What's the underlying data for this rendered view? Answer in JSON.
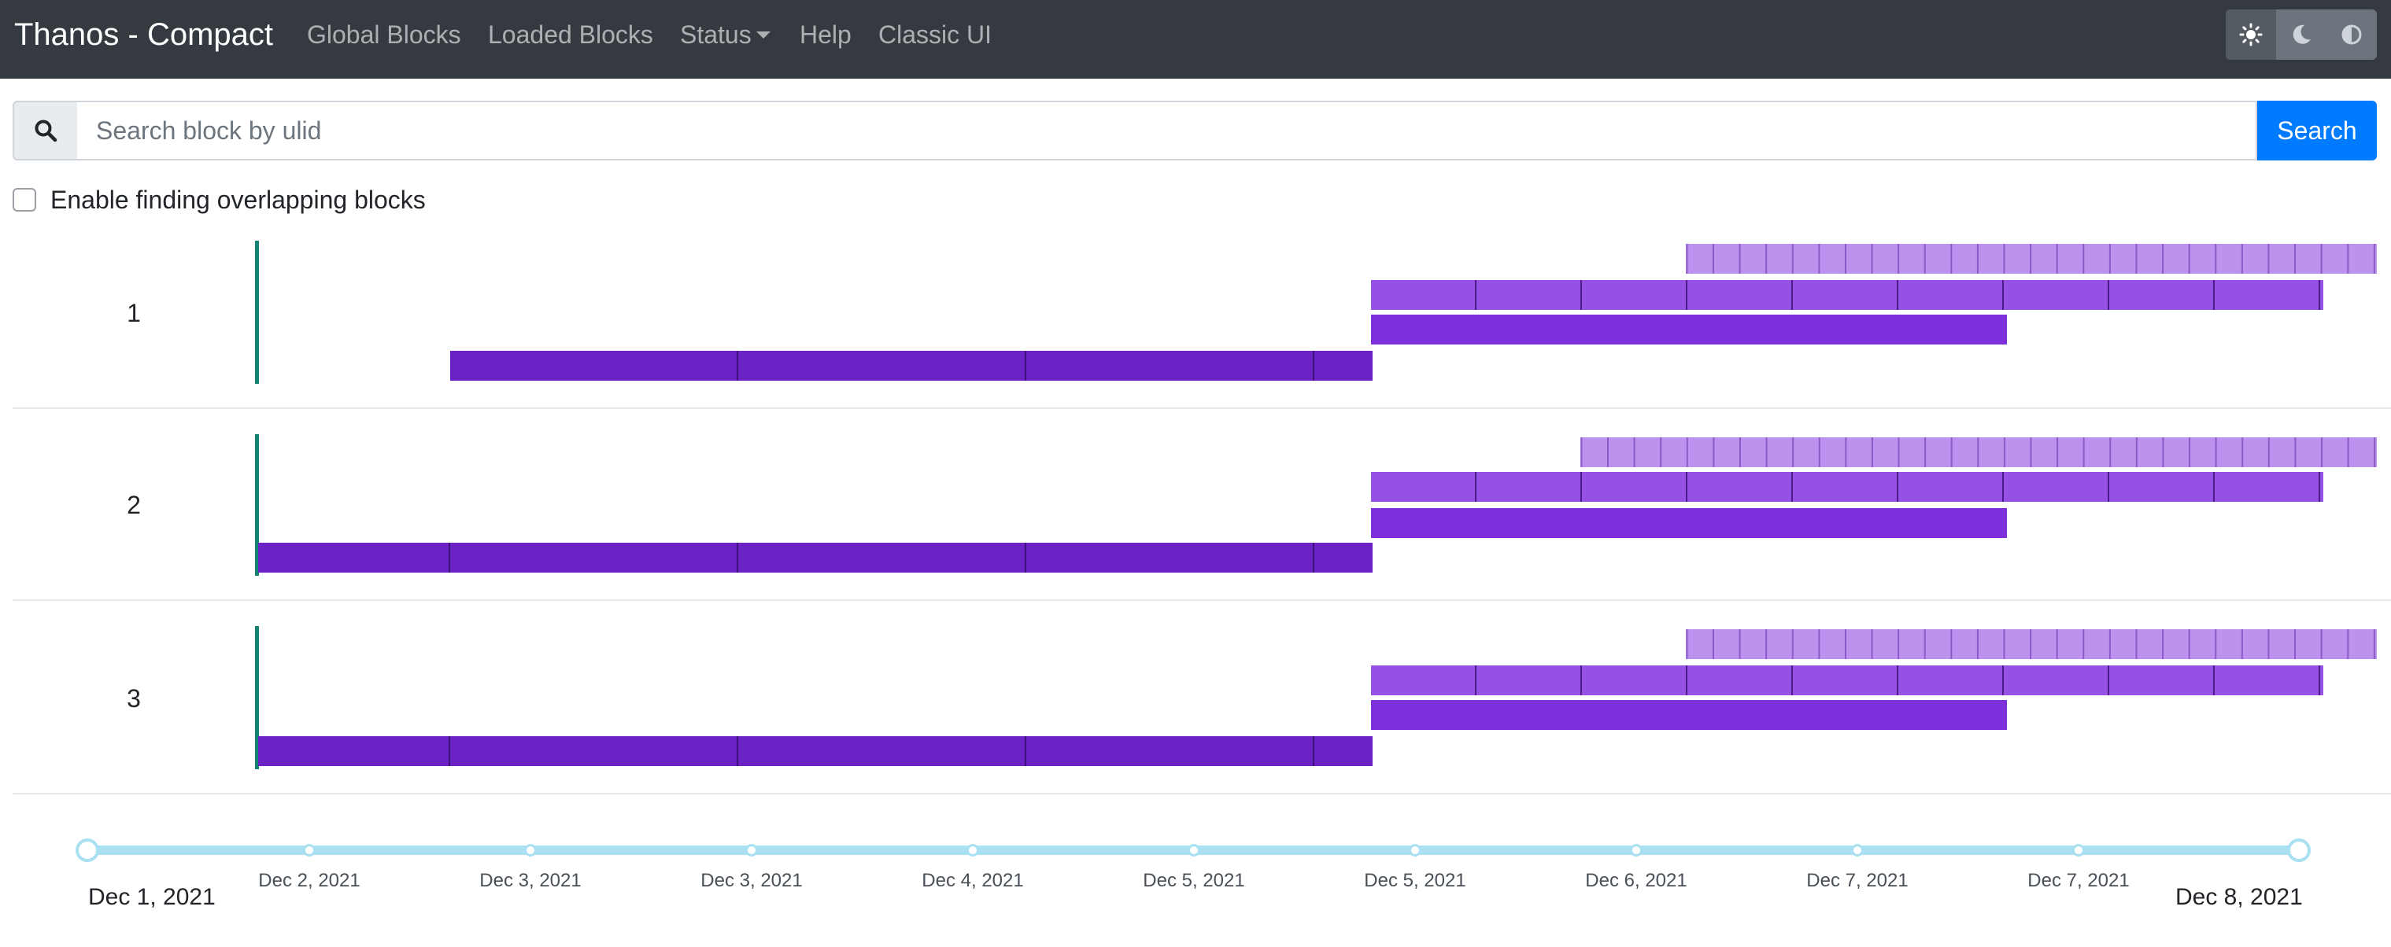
{
  "navbar": {
    "brand": "Thanos - Compact",
    "links": [
      "Global Blocks",
      "Loaded Blocks",
      "Status",
      "Help",
      "Classic UI"
    ],
    "theme_icons": [
      "sun-icon",
      "moon-icon",
      "contrast-icon"
    ]
  },
  "search": {
    "placeholder": "Search block by ulid",
    "button_label": "Search",
    "icon": "search-icon"
  },
  "options": {
    "overlap_label": "Enable finding overlapping blocks",
    "overlap_checked": false
  },
  "rows": [
    {
      "label": "1"
    },
    {
      "label": "2"
    },
    {
      "label": "3"
    }
  ],
  "timeline": {
    "start_label": "Dec 1, 2021",
    "end_label": "Dec 8, 2021",
    "ticks": [
      "Dec 2, 2021",
      "Dec 3, 2021",
      "Dec 3, 2021",
      "Dec 4, 2021",
      "Dec 5, 2021",
      "Dec 5, 2021",
      "Dec 6, 2021",
      "Dec 7, 2021",
      "Dec 7, 2021"
    ]
  },
  "colors": {
    "navbar": "#343a40",
    "primary": "#007bff",
    "row_axis": "#118474",
    "block_level_1": "#6a22c4",
    "block_level_2": "#7d2fdb",
    "block_level_3": "#9551e4",
    "block_level_4": "#bb92ee",
    "timeline": "#a9e1f2"
  }
}
